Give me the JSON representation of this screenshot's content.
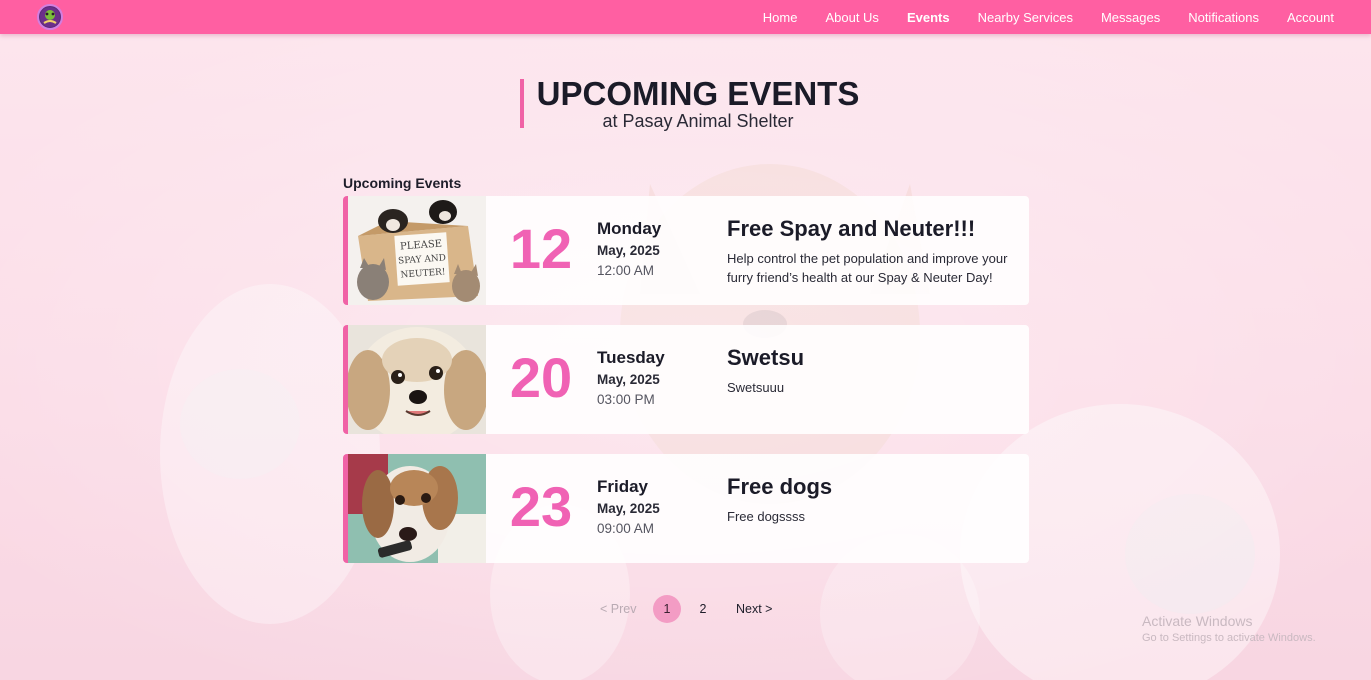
{
  "nav": {
    "logo_alt": "Pasay Animal Shelter logo",
    "links": [
      "Home",
      "About Us",
      "Events",
      "Nearby Services",
      "Messages",
      "Notifications",
      "Account"
    ],
    "active": "Events"
  },
  "header": {
    "title": "UPCOMING EVENTS",
    "subtitle": "at Pasay Animal Shelter"
  },
  "section_heading": "Upcoming Events",
  "events": [
    {
      "day": "12",
      "weekday": "Monday",
      "month_year": "May, 2025",
      "time": "12:00 AM",
      "title": "Free Spay and Neuter!!!",
      "description": "Help control the pet population and improve your furry friend’s health at our Spay & Neuter Day!",
      "image_text": "PLEASE SPAY AND NEUTER!"
    },
    {
      "day": "20",
      "weekday": "Tuesday",
      "month_year": "May, 2025",
      "time": "03:00 PM",
      "title": "Swetsu",
      "description": "Swetsuuu"
    },
    {
      "day": "23",
      "weekday": "Friday",
      "month_year": "May, 2025",
      "time": "09:00 AM",
      "title": "Free dogs",
      "description": "Free dogssss"
    }
  ],
  "pagination": {
    "prev": "< Prev",
    "pages": [
      "1",
      "2"
    ],
    "current": 1,
    "next": "Next >"
  },
  "watermark": {
    "title": "Activate Windows",
    "subtitle": "Go to Settings to activate Windows."
  },
  "colors": {
    "nav_bg": "#ff5fa2",
    "accent": "#f062a6",
    "day_number": "#f062b4",
    "page_current": "#f39cc4"
  }
}
